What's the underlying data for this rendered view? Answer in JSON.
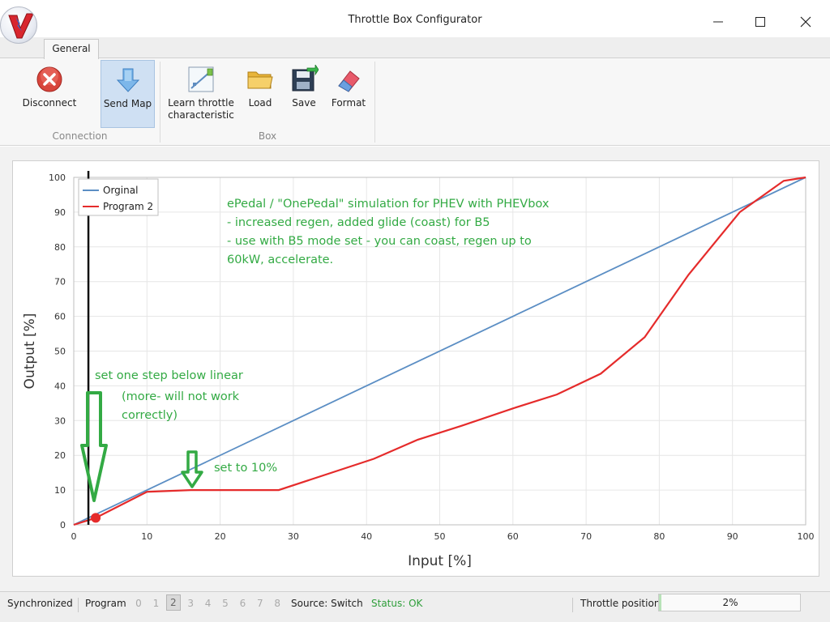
{
  "window": {
    "title": "Throttle Box Configurator",
    "logo_text": "V"
  },
  "ribbon": {
    "tab_label": "General",
    "groups": {
      "connection": "Connection",
      "box": "Box"
    },
    "buttons": {
      "disconnect": "Disconnect",
      "send_map": "Send Map",
      "learn_line1": "Learn throttle",
      "learn_line2": "characteristic",
      "load": "Load",
      "save": "Save",
      "format": "Format"
    }
  },
  "chart_data": {
    "type": "line",
    "xlabel": "Input [%]",
    "ylabel": "Output [%]",
    "xlim": [
      0,
      100
    ],
    "ylim": [
      0,
      100
    ],
    "xticks": [
      0,
      10,
      20,
      30,
      40,
      50,
      60,
      70,
      80,
      90,
      100
    ],
    "yticks": [
      0,
      10,
      20,
      30,
      40,
      50,
      60,
      70,
      80,
      90,
      100
    ],
    "grid": true,
    "legend_position": "top-left",
    "series": [
      {
        "name": "Orginal",
        "color": "#5b8ec4",
        "x": [
          0,
          100
        ],
        "y": [
          0,
          100
        ]
      },
      {
        "name": "Program 2",
        "color": "#e52b2b",
        "x": [
          0,
          3,
          10,
          16,
          28,
          41,
          47,
          53,
          60,
          66,
          72,
          78,
          84,
          91,
          97,
          100
        ],
        "y": [
          0,
          2,
          9.5,
          10,
          10,
          19,
          24.5,
          28.5,
          33.5,
          37.5,
          43.5,
          54,
          72,
          90,
          99,
          100
        ]
      }
    ],
    "cursor_x": 2,
    "marker": {
      "x": 3,
      "y": 2
    },
    "annotations": {
      "main_lines": [
        "ePedal / \"OnePedal\" simulation for PHEV with PHEVbox",
        "- increased regen, added glide (coast) for B5",
        "- use with B5 mode set - you can coast, regen up to",
        "60kW, accelerate."
      ],
      "step_lines": [
        "set one step below linear",
        "(more- will not work",
        "correctly)"
      ],
      "set10": "set to 10%",
      "color": "#33aa44"
    }
  },
  "statusbar": {
    "sync": "Synchronized",
    "program_label": "Program",
    "program_numbers": [
      "0",
      "1",
      "2",
      "3",
      "4",
      "5",
      "6",
      "7",
      "8"
    ],
    "active_program": "2",
    "source": "Source: Switch",
    "status": "Status: OK",
    "status_color": "#2e9e3a",
    "throttle_label": "Throttle position",
    "throttle_value": "2%",
    "throttle_fraction": 0.02
  }
}
